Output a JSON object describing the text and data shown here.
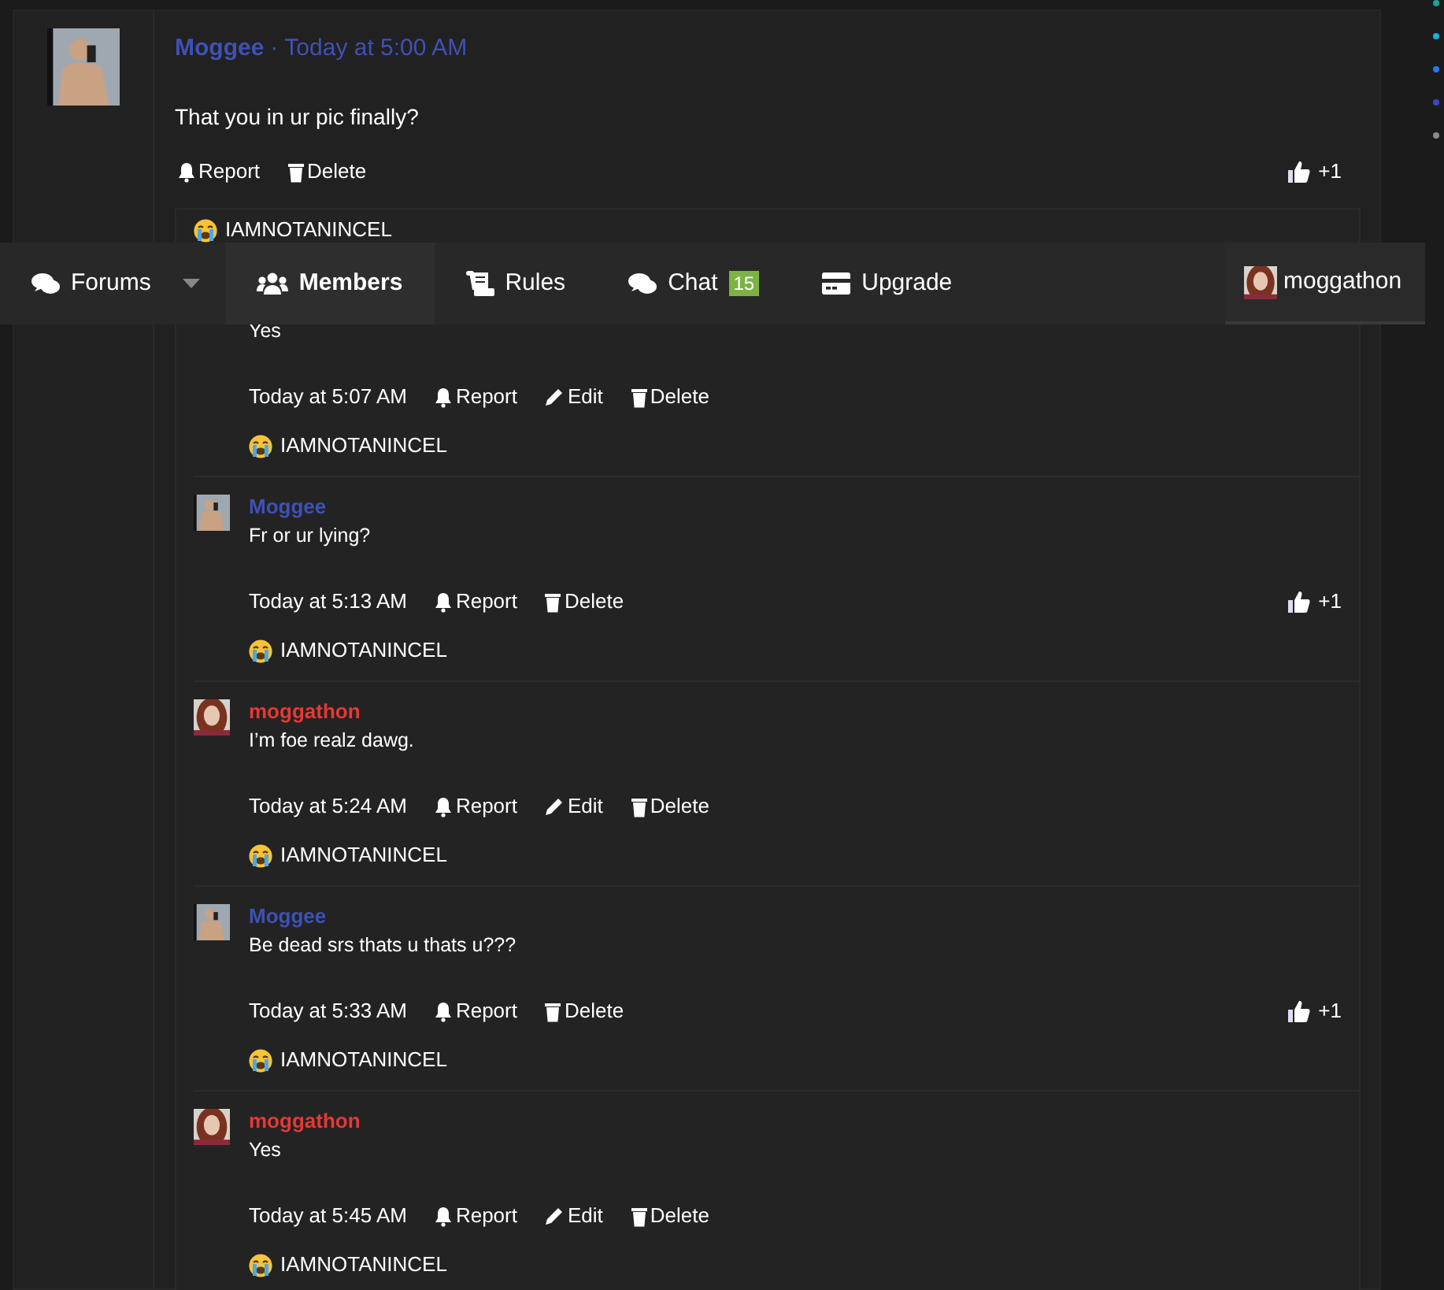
{
  "nav": {
    "items": [
      {
        "kind": "menu",
        "label": "Forums",
        "selected": false
      },
      {
        "kind": "link",
        "label": "Members",
        "selected": true
      },
      {
        "kind": "link",
        "label": "Rules",
        "selected": false
      },
      {
        "kind": "link",
        "label": "Chat",
        "selected": false,
        "badge": "15"
      },
      {
        "kind": "link",
        "label": "Upgrade",
        "selected": false
      }
    ],
    "user": {
      "name": "moggathon"
    }
  },
  "post": {
    "author": "Moggee",
    "separator": "·",
    "time": "Today at 5:00 AM",
    "text": "That you in ur pic finally?",
    "actions": [
      {
        "kind": "report",
        "label": "Report"
      },
      {
        "kind": "delete",
        "label": "Delete"
      }
    ],
    "likes": "+1"
  },
  "replies": {
    "leading_reaction": "IAMNOTANINCEL",
    "items": [
      {
        "text": "Yes",
        "time": "Today at 5:07 AM",
        "actions": [
          {
            "kind": "report",
            "label": "Report"
          },
          {
            "kind": "edit",
            "label": "Edit"
          },
          {
            "kind": "delete",
            "label": "Delete"
          }
        ],
        "reaction": "IAMNOTANINCEL"
      },
      {
        "author": "Moggee",
        "kind": "other",
        "text": "Fr or ur lying?",
        "time": "Today at 5:13 AM",
        "actions": [
          {
            "kind": "report",
            "label": "Report"
          },
          {
            "kind": "delete",
            "label": "Delete"
          }
        ],
        "likes": "+1",
        "reaction": "IAMNOTANINCEL"
      },
      {
        "author": "moggathon",
        "kind": "self",
        "text": "I’m foe realz dawg.",
        "time": "Today at 5:24 AM",
        "actions": [
          {
            "kind": "report",
            "label": "Report"
          },
          {
            "kind": "edit",
            "label": "Edit"
          },
          {
            "kind": "delete",
            "label": "Delete"
          }
        ],
        "reaction": "IAMNOTANINCEL"
      },
      {
        "author": "Moggee",
        "kind": "other",
        "text": "Be dead srs thats u thats u???",
        "time": "Today at 5:33 AM",
        "actions": [
          {
            "kind": "report",
            "label": "Report"
          },
          {
            "kind": "delete",
            "label": "Delete"
          }
        ],
        "likes": "+1",
        "reaction": "IAMNOTANINCEL"
      },
      {
        "author": "moggathon",
        "kind": "self",
        "text": "Yes",
        "time": "Today at 5:45 AM",
        "actions": [
          {
            "kind": "report",
            "label": "Report"
          },
          {
            "kind": "edit",
            "label": "Edit"
          },
          {
            "kind": "delete",
            "label": "Delete"
          }
        ],
        "reaction": "IAMNOTANINCEL"
      }
    ]
  },
  "side_dots": [
    {
      "color": "#1aa39a"
    },
    {
      "color": "#1ab0e0"
    },
    {
      "color": "#1e7cf0"
    },
    {
      "color": "#3848c8"
    },
    {
      "color": "#8a8a8a"
    }
  ]
}
